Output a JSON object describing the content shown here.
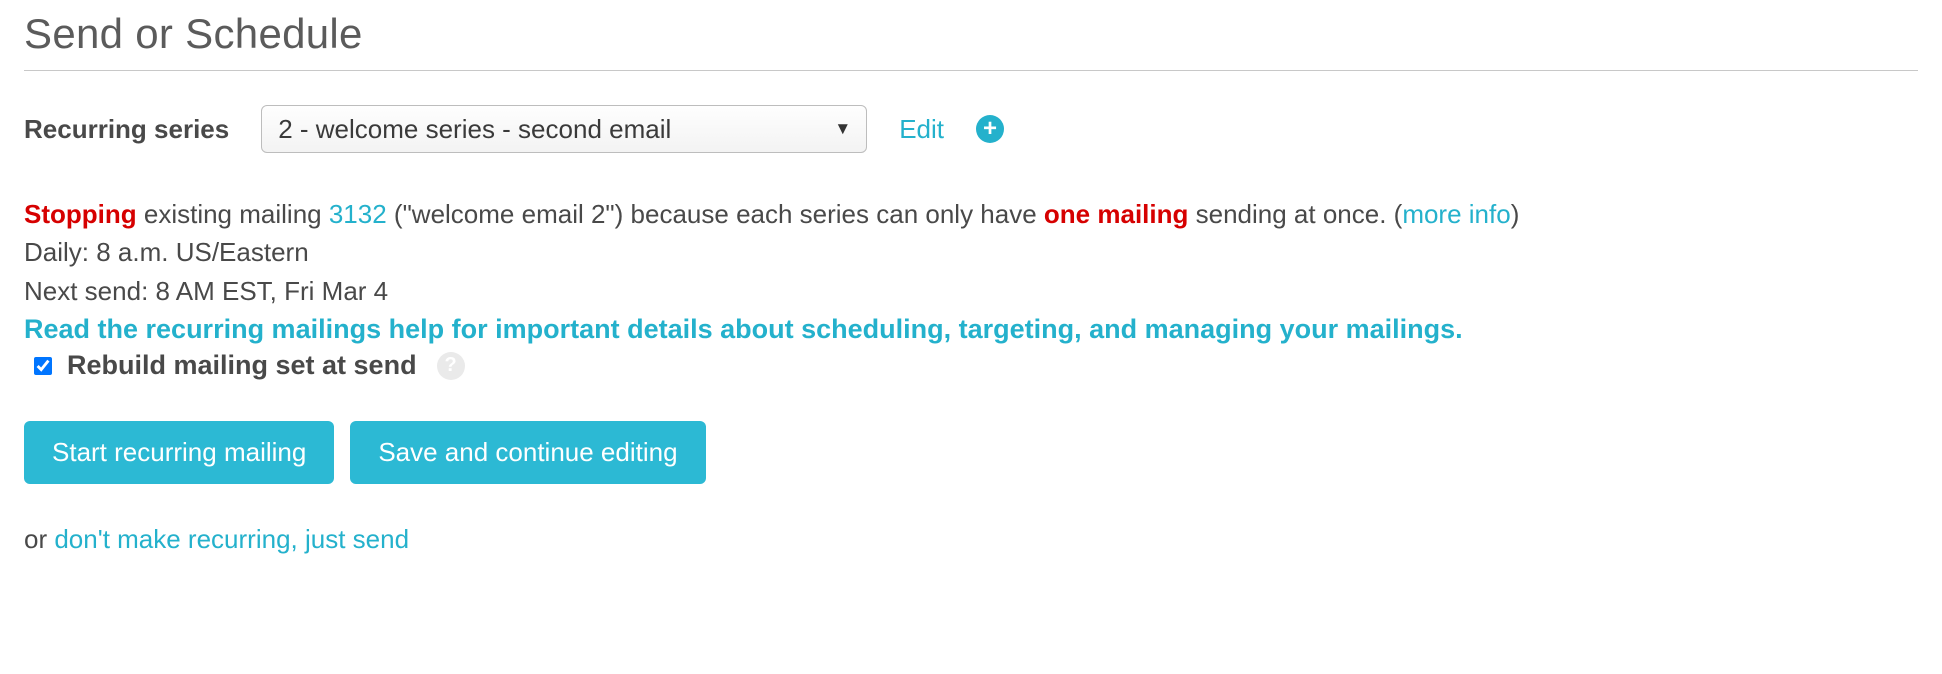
{
  "page": {
    "title": "Send or Schedule"
  },
  "recurring": {
    "label": "Recurring series",
    "selected": "2 - welcome series - second email",
    "edit_label": "Edit"
  },
  "stopping": {
    "stopping_word": "Stopping",
    "before_id": " existing mailing ",
    "mailing_id": "3132",
    "after_id": " (\"welcome email 2\") because each series can only have ",
    "one_mailing": "one mailing",
    "after_bold": " sending at once. (",
    "more_info": "more info",
    "after_link": ")"
  },
  "schedule": {
    "daily_line": "Daily: 8 a.m. US/Eastern",
    "next_send_line": "Next send: 8 AM EST, Fri Mar 4"
  },
  "help_link": "Read the recurring mailings help for important details about scheduling, targeting, and managing your mailings.",
  "rebuild": {
    "label": "Rebuild mailing set at send",
    "checked": true
  },
  "buttons": {
    "start": "Start recurring mailing",
    "save": "Save and continue editing"
  },
  "or_text": "or ",
  "dont_recurring_link": "don't make recurring, just send"
}
